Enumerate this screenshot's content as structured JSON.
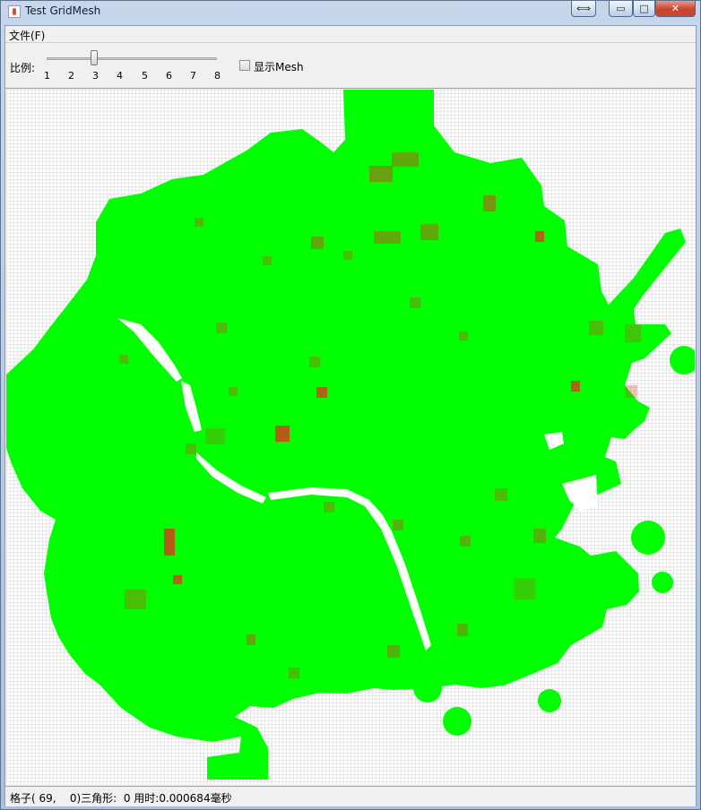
{
  "window": {
    "title": "Test GridMesh",
    "restore_icon": "⟺",
    "min_icon": "▭",
    "max_icon": "□",
    "close_icon": "✕"
  },
  "menu": {
    "file_label": "文件(F)"
  },
  "toolbar": {
    "scale_label": "比例:",
    "scale_ticks": [
      "1",
      "2",
      "3",
      "4",
      "5",
      "6",
      "7",
      "8"
    ],
    "scale_value": 3,
    "show_mesh_label": "显示Mesh",
    "show_mesh_checked": false
  },
  "canvas": {
    "walkable_color": "#00ff00",
    "hotspot_color": "#d3411a",
    "grid_color": "#e6e6e6"
  },
  "status": {
    "text": "格子( 69,    0)三角形:  0 用时:0.000684毫秒"
  }
}
